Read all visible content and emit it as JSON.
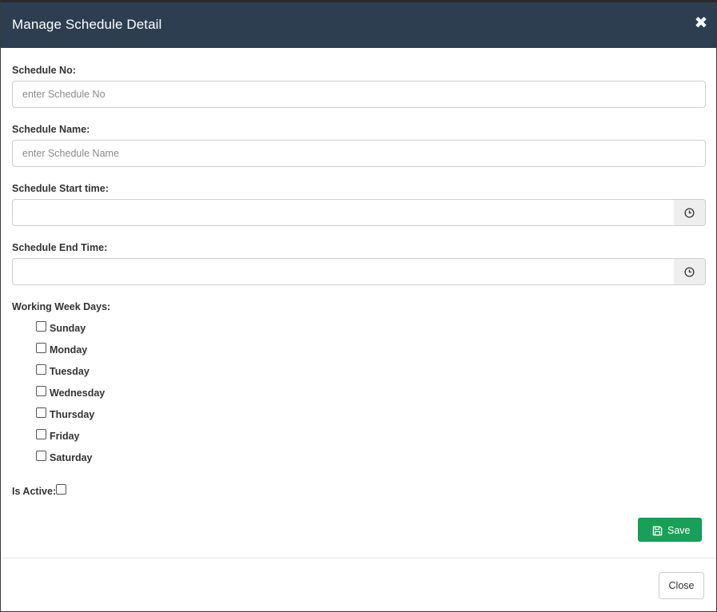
{
  "header": {
    "title": "Manage Schedule Detail",
    "close_symbol": "✖"
  },
  "form": {
    "schedule_no": {
      "label": "Schedule No:",
      "placeholder": "enter Schedule No",
      "value": ""
    },
    "schedule_name": {
      "label": "Schedule Name:",
      "placeholder": "enter Schedule Name",
      "value": ""
    },
    "start_time": {
      "label": "Schedule Start time:",
      "value": "",
      "icon": "clock-icon"
    },
    "end_time": {
      "label": "Schedule End Time:",
      "value": "",
      "icon": "clock-icon"
    },
    "working_days": {
      "label": "Working Week Days:",
      "days": [
        {
          "label": "Sunday",
          "checked": false
        },
        {
          "label": "Monday",
          "checked": false
        },
        {
          "label": "Tuesday",
          "checked": false
        },
        {
          "label": "Wednesday",
          "checked": false
        },
        {
          "label": "Thursday",
          "checked": false
        },
        {
          "label": "Friday",
          "checked": false
        },
        {
          "label": "Saturday",
          "checked": false
        }
      ]
    },
    "is_active": {
      "label": "Is Active:",
      "checked": false
    }
  },
  "actions": {
    "save_label": "Save",
    "save_icon": "floppy-disk-icon",
    "close_label": "Close"
  },
  "colors": {
    "header_bg": "#2c3e50",
    "save_bg": "#18a058",
    "addon_bg": "#eeeeee"
  }
}
